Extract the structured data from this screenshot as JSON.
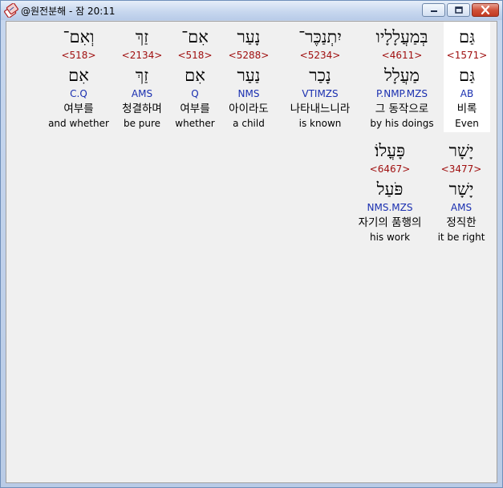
{
  "window": {
    "title": "@원전분해 - 잠 20:11"
  },
  "words": [
    {
      "hebrew": "גַּם",
      "strong": "<1571>",
      "lemma": "גַּם",
      "morph": "AB",
      "korean": "비록",
      "english": "Even",
      "highlighted": true
    },
    {
      "hebrew": "בְּמַעֲלָלָיו",
      "strong": "<4611>",
      "lemma": "מַעֲלָל",
      "morph": "P.NMP.MZS",
      "korean": "그 동작으로",
      "english": "by his doings",
      "highlighted": false
    },
    {
      "hebrew": "יִתְנַכֶּר־",
      "strong": "<5234>",
      "lemma": "נָכַר",
      "morph": "VTIMZS",
      "korean": "나타내느니라",
      "english": "is known",
      "highlighted": false
    },
    {
      "hebrew": "נָעַר",
      "strong": "<5288>",
      "lemma": "נַעַר",
      "morph": "NMS",
      "korean": "아이라도",
      "english": "a child",
      "highlighted": false
    },
    {
      "hebrew": "אִם־",
      "strong": "<518>",
      "lemma": "אִם",
      "morph": "Q",
      "korean": "여부를",
      "english": "whether",
      "highlighted": false
    },
    {
      "hebrew": "זַךְ",
      "strong": "<2134>",
      "lemma": "זַךְ",
      "morph": "AMS",
      "korean": "청결하며",
      "english": "be pure",
      "highlighted": false
    },
    {
      "hebrew": "וְאִם־",
      "strong": "<518>",
      "lemma": "אִם",
      "morph": "C.Q",
      "korean": "여부를",
      "english": "and whether",
      "highlighted": false
    },
    {
      "hebrew": "יָשָׁר",
      "strong": "<3477>",
      "lemma": "יָשָׁר",
      "morph": "AMS",
      "korean": "정직한",
      "english": "it be right",
      "highlighted": false
    },
    {
      "hebrew": "פָּעֳלוֹ׃",
      "strong": "<6467>",
      "lemma": "פֹּעַל",
      "morph": "NMS.MZS",
      "korean": "자기의 품행의",
      "english": "his work",
      "highlighted": false
    }
  ]
}
